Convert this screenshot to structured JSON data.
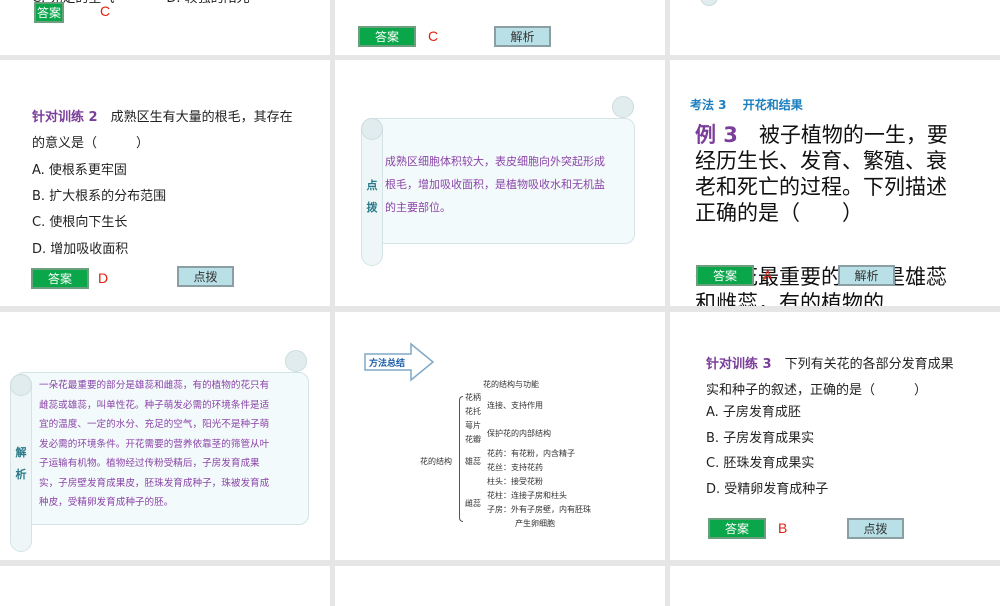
{
  "slides": {
    "s_top_left": {
      "options_line": "C. 充足的空气　　　　D. 较强的阳光",
      "answer_label": "答案",
      "answer": "C"
    },
    "s_top_mid": {
      "answer_label": "答案",
      "answer": "C",
      "analysis_label": "解析"
    },
    "s_train2": {
      "title": "针对训练 2",
      "question": "成熟区生有大量的根毛，其存在的意义是（　　　）",
      "options": [
        "A. 使根系更牢固",
        "B. 扩大根系的分布范围",
        "C. 使根向下生长",
        "D. 增加吸收面积"
      ],
      "answer_label": "答案",
      "answer": "D",
      "tip_label": "点拨"
    },
    "s_tip2": {
      "side_label": "点拨",
      "text": "成熟区细胞体积较大，表皮细胞向外突起形成根毛，增加吸收面积，是植物吸收水和无机盐的主要部位。"
    },
    "s_example3": {
      "section": "考法 3　 开花和结果",
      "title": "例 3",
      "question": "被子植物的一生，要经历生长、发育、繁殖、衰老和死亡的过程。下列描述正确的是（　　）",
      "overflow_text": "一朵花最重要的部分是雄蕊和雌蕊，有的植物的",
      "answer_label": "答案",
      "answer": "A",
      "analysis_label": "解析"
    },
    "s_analysis3": {
      "side_label": "解析",
      "text": "一朵花最重要的部分是雄蕊和雌蕊，有的植物的花只有雌蕊或雄蕊，叫单性花。种子萌发必需的环境条件是适宜的温度、一定的水分、充足的空气，阳光不是种子萌发必需的环境条件。开花需要的营养依靠茎的筛管从叶子运输有机物。植物经过传粉受精后，子房发育成果实，子房壁发育成果皮，胚珠发育成种子，珠被发育成种皮，受精卵发育成种子的胚。"
    },
    "s_method": {
      "banner": "方法总结",
      "diagram_title": "花的结构与功能",
      "root": "花的结构",
      "rows": [
        "花柄",
        "花托",
        "连接、支持作用",
        "萼片",
        "花瓣",
        "保护花的内部结构",
        "雄蕊",
        "花药：有花粉，内含精子",
        "花丝：支持花药",
        "雌蕊",
        "柱头：接受花粉",
        "花柱：连接子房和柱头",
        "子房：外有子房壁，内有胚珠",
        "产生卵细胞"
      ]
    },
    "s_train3": {
      "title": "针对训练 3",
      "question": "下列有关花的各部分发育成果实和种子的叙述，正确的是（　　　）",
      "options": [
        "A. 子房发育成胚",
        "B. 子房发育成果实",
        "C. 胚珠发育成果实",
        "D. 受精卵发育成种子"
      ],
      "answer_label": "答案",
      "answer": "B",
      "tip_label": "点拨"
    }
  }
}
